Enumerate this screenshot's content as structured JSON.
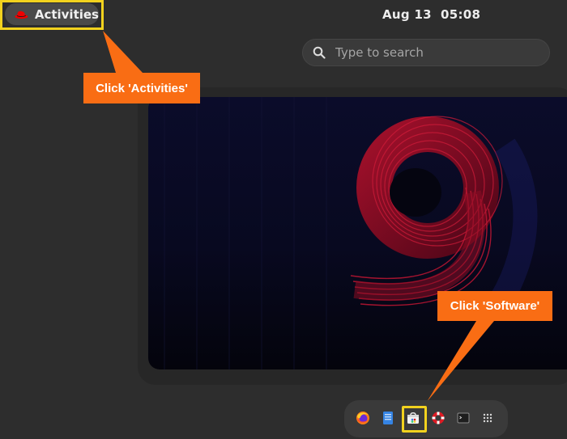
{
  "topbar": {
    "activities_label": "Activities",
    "date": "Aug 13",
    "time": "05:08"
  },
  "search": {
    "placeholder": "Type to search"
  },
  "callouts": {
    "activities": "Click 'Activities'",
    "software": "Click 'Software'"
  },
  "dash": {
    "items": [
      "Firefox",
      "Files",
      "Software",
      "Help",
      "Terminal",
      "Show Applications"
    ]
  },
  "colors": {
    "highlight": "#f2d21e",
    "callout": "#f96d14",
    "brand_red": "#ee0000"
  }
}
